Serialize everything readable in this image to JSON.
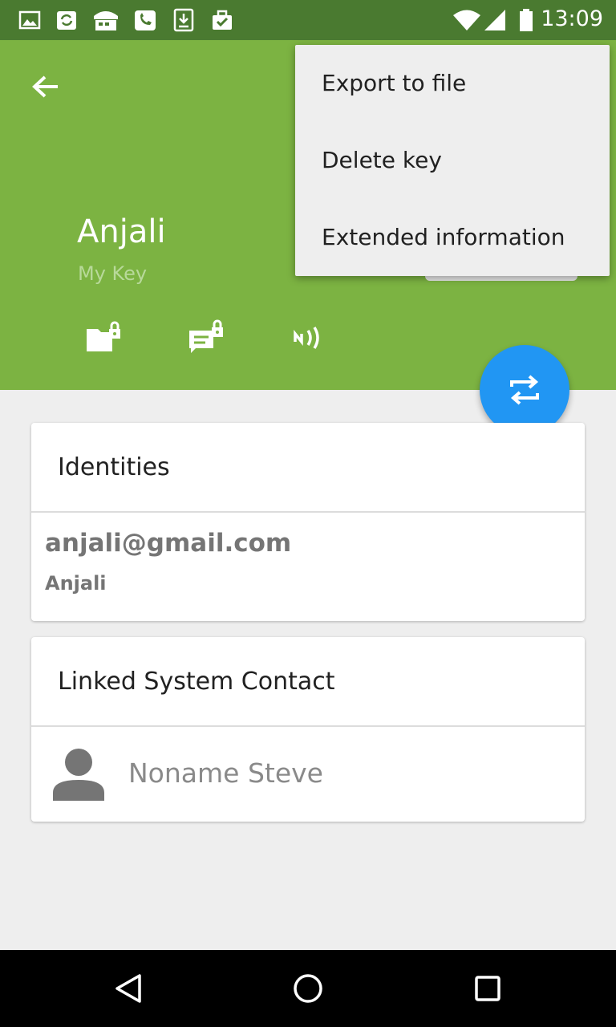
{
  "status_bar": {
    "time": "13:09",
    "notification_icons": [
      "image-icon",
      "sync-app-icon",
      "store-icon",
      "phone-app-icon",
      "download-icon",
      "briefcase-check-icon"
    ],
    "system_icons": [
      "wifi-icon",
      "signal-icon",
      "battery-icon"
    ]
  },
  "header": {
    "color": "#7cb342",
    "key_name": "Anjali",
    "key_subtitle": "My Key",
    "actions": [
      "encrypt-files-icon",
      "encrypt-text-icon",
      "nfc-share-icon"
    ]
  },
  "menu": {
    "items": [
      {
        "label": "Export to file"
      },
      {
        "label": "Delete key"
      },
      {
        "label": "Extended information"
      }
    ]
  },
  "fab": {
    "icon": "exchange-arrows-icon",
    "color": "#2196f3"
  },
  "identities_card": {
    "title": "Identities",
    "email": "anjali@gmail.com",
    "name": "Anjali"
  },
  "linked_contact_card": {
    "title": "Linked System Contact",
    "contact_name": "Noname Steve"
  },
  "nav_bar": {
    "buttons": [
      "back-triangle-icon",
      "home-circle-icon",
      "recents-square-icon"
    ]
  }
}
